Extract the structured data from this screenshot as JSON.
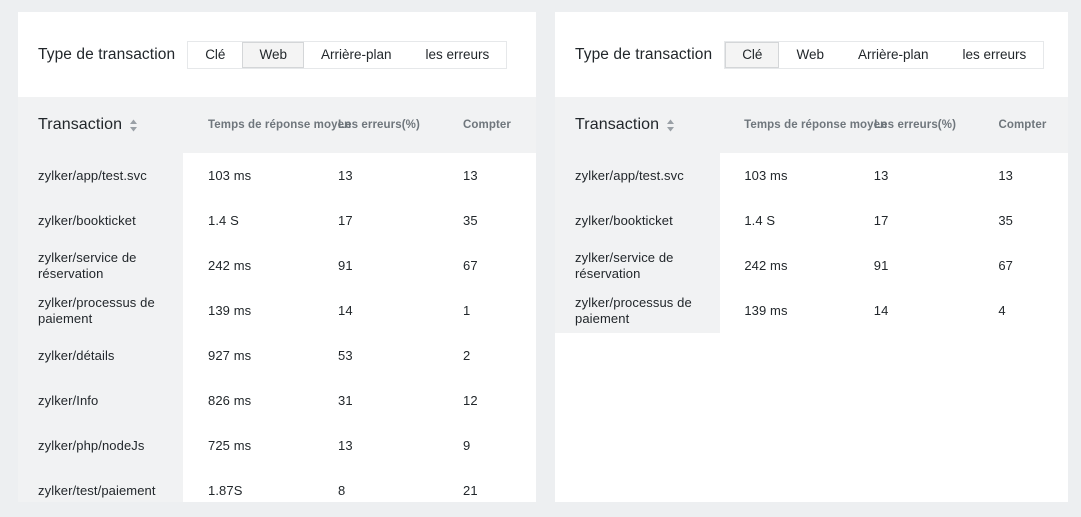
{
  "panels": [
    {
      "filter": {
        "label": "Type de transaction",
        "tabs": [
          {
            "label": "Clé",
            "selected": false
          },
          {
            "label": "Web",
            "selected": true
          },
          {
            "label": "Arrière-plan",
            "selected": false
          },
          {
            "label": "les erreurs",
            "selected": false
          }
        ]
      },
      "table": {
        "columns": [
          "Transaction",
          "Temps de réponse moyen",
          "Les erreurs(%)",
          "Compter"
        ],
        "sort_icon": "sort-updown-icon",
        "rows": [
          {
            "name": "zylker/app/test.svc",
            "time": "103 ms",
            "errors": "13",
            "count": "13"
          },
          {
            "name": "zylker/bookticket",
            "time": "1.4 S",
            "errors": "17",
            "count": "35"
          },
          {
            "name": "zylker/service de réservation",
            "time": "242 ms",
            "errors": "91",
            "count": "67"
          },
          {
            "name": "zylker/processus de paiement",
            "time": "139 ms",
            "errors": "14",
            "count": "1"
          },
          {
            "name": "zylker/détails",
            "time": "927 ms",
            "errors": "53",
            "count": "2"
          },
          {
            "name": "zylker/Info",
            "time": "826 ms",
            "errors": "31",
            "count": "12"
          },
          {
            "name": "zylker/php/nodeJs",
            "time": "725 ms",
            "errors": "13",
            "count": "9"
          },
          {
            "name": "zylker/test/paiement",
            "time": "1.87S",
            "errors": "8",
            "count": "21"
          }
        ]
      }
    },
    {
      "filter": {
        "label": "Type de transaction",
        "tabs": [
          {
            "label": "Clé",
            "selected": true
          },
          {
            "label": "Web",
            "selected": false
          },
          {
            "label": "Arrière-plan",
            "selected": false
          },
          {
            "label": "les erreurs",
            "selected": false
          }
        ]
      },
      "table": {
        "columns": [
          "Transaction",
          "Temps de réponse moyen",
          "Les erreurs(%)",
          "Compter"
        ],
        "sort_icon": "sort-updown-icon",
        "rows": [
          {
            "name": "zylker/app/test.svc",
            "time": "103 ms",
            "errors": "13",
            "count": "13"
          },
          {
            "name": "zylker/bookticket",
            "time": "1.4 S",
            "errors": "17",
            "count": "35"
          },
          {
            "name": "zylker/service de réservation",
            "time": "242 ms",
            "errors": "91",
            "count": "67"
          },
          {
            "name": "zylker/processus de paiement",
            "time": "139 ms",
            "errors": "14",
            "count": "4"
          }
        ]
      }
    }
  ],
  "colors": {
    "page_background": "#edeff1",
    "panel_background": "#ffffff",
    "header_background": "#f1f2f3",
    "selected_tab_background": "#f4f4f4",
    "text": "#22272b",
    "muted_text": "#6f767c"
  }
}
